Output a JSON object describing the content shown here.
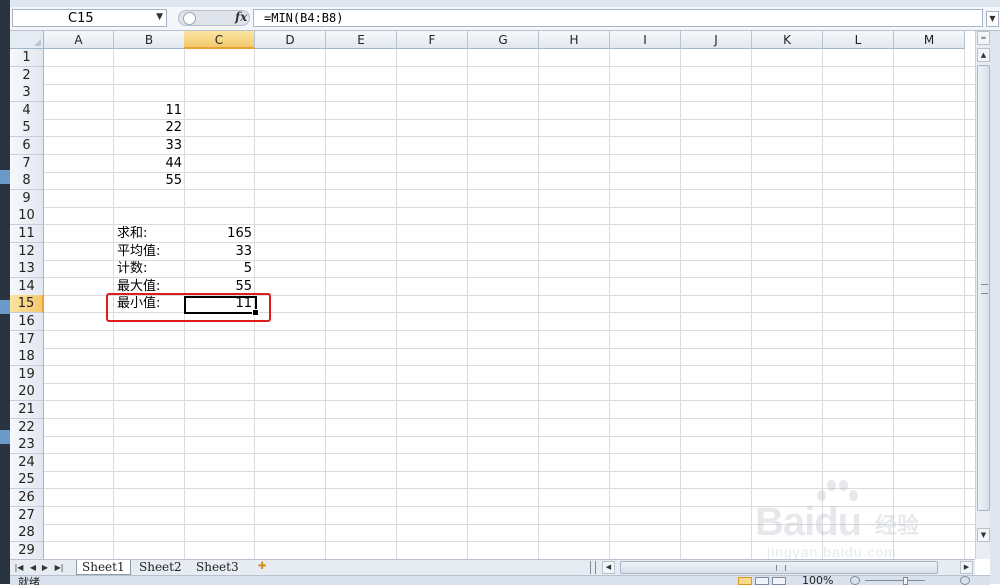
{
  "formula_bar": {
    "name_box": "C15",
    "fx_label": "fx",
    "formula": "=MIN(B4:B8)"
  },
  "grid": {
    "columns": [
      "A",
      "B",
      "C",
      "D",
      "E",
      "F",
      "G",
      "H",
      "I",
      "J",
      "K",
      "L",
      "M"
    ],
    "selected_column": "C",
    "rows": [
      "1",
      "2",
      "3",
      "4",
      "5",
      "6",
      "7",
      "8",
      "9",
      "10",
      "11",
      "12",
      "13",
      "14",
      "15",
      "16",
      "17",
      "18",
      "19",
      "20",
      "21",
      "22",
      "23",
      "24",
      "25",
      "26",
      "27",
      "28",
      "29"
    ],
    "selected_row": "15",
    "cells": {
      "B4": "11",
      "B5": "22",
      "B6": "33",
      "B7": "44",
      "B8": "55",
      "B11": "求和:",
      "C11": "165",
      "B12": "平均值:",
      "C12": "33",
      "B13": "计数:",
      "C13": "5",
      "B14": "最大值:",
      "C14": "55",
      "B15": "最小值:",
      "C15": "11"
    },
    "active_cell": "C15"
  },
  "sheet_tabs": [
    "Sheet1",
    "Sheet2",
    "Sheet3"
  ],
  "active_sheet": "Sheet1",
  "status_bar": {
    "ready_text": "就绪",
    "zoom": "100%"
  },
  "watermark": {
    "brand": "Baidu",
    "brand_cn": "经验",
    "url": "jingyan.baidu.com"
  },
  "colors": {
    "highlight_box": "#e11b1b",
    "selected_header": "#f4c96c"
  }
}
